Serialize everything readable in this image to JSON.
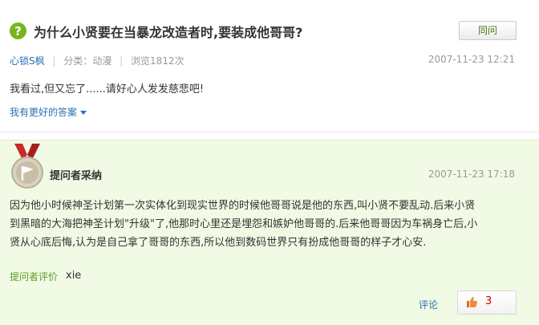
{
  "question": {
    "icon": "?",
    "title": "为什么小贤要在当暴龙改造者时,要装成他哥哥?",
    "same_button": "同问",
    "meta": {
      "user": "心锁S枫",
      "category": "分类：动漫",
      "views": "浏览1812次",
      "time": "2007-11-23 12:21"
    },
    "body": "我看过,但又忘了......请好心人发发慈悲吧!",
    "better_answer_link": "我有更好的答案"
  },
  "answer": {
    "title": "提问者采纳",
    "time": "2007-11-23 17:18",
    "lines": [
      "因为他小时候神圣计划第一次实体化到现实世界的时候他哥哥说是他的东西,叫小贤不要乱动.后来小贤",
      "到黑暗的大海把神圣计划\"升级\"了,他那时心里还是埋怨和嫉妒他哥哥的.后来他哥哥因为车祸身亡后,小",
      "贤从心底后悔,认为是自己拿了哥哥的东西,所以他到数码世界只有扮成他哥哥的样子才心安."
    ],
    "evaluation_label": "提问者评价",
    "evaluation_value": "xie",
    "comment_link": "评论",
    "like_count": "3"
  },
  "colors": {
    "answer_bg": "#f1fae4",
    "accent_green": "#77b51c",
    "link_blue": "#2b6fb6",
    "like_red": "#cc0000"
  },
  "icons": [
    "question-mark-icon",
    "medal-icon",
    "caret-down-icon",
    "thumbs-up-icon"
  ]
}
